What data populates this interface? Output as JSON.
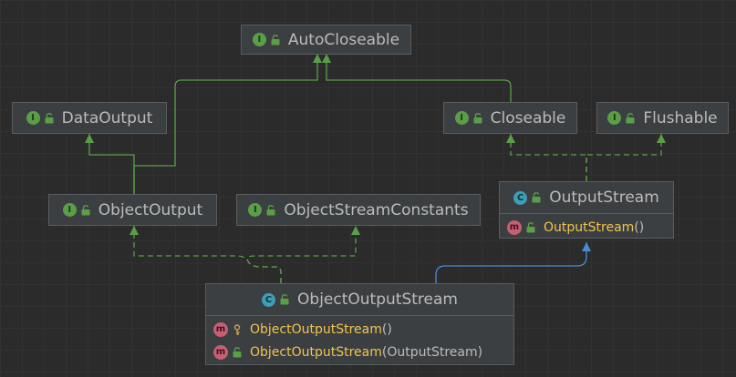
{
  "diagram": {
    "nodes": {
      "autocloseable": {
        "badge": "I",
        "name": "AutoCloseable"
      },
      "dataoutput": {
        "badge": "I",
        "name": "DataOutput"
      },
      "closeable": {
        "badge": "I",
        "name": "Closeable"
      },
      "flushable": {
        "badge": "I",
        "name": "Flushable"
      },
      "objectoutput": {
        "badge": "I",
        "name": "ObjectOutput"
      },
      "objectstreamconstants": {
        "badge": "I",
        "name": "ObjectStreamConstants"
      },
      "outputstream": {
        "badge": "C",
        "name": "OutputStream",
        "members": [
          {
            "badge": "m",
            "name": "OutputStream",
            "params": "()"
          }
        ]
      },
      "objectoutputstream": {
        "badge": "C",
        "name": "ObjectOutputStream",
        "members": [
          {
            "badge": "m",
            "name": "ObjectOutputStream",
            "params": "()"
          },
          {
            "badge": "m",
            "name": "ObjectOutputStream",
            "params": "(OutputStream)"
          }
        ]
      }
    },
    "colors": {
      "extends_interface": "#5a9e48",
      "implements_interface": "#5a9e48",
      "extends_class": "#4a8bd6",
      "method_name": "#f0c54e",
      "text": "#bbbbbb"
    }
  }
}
